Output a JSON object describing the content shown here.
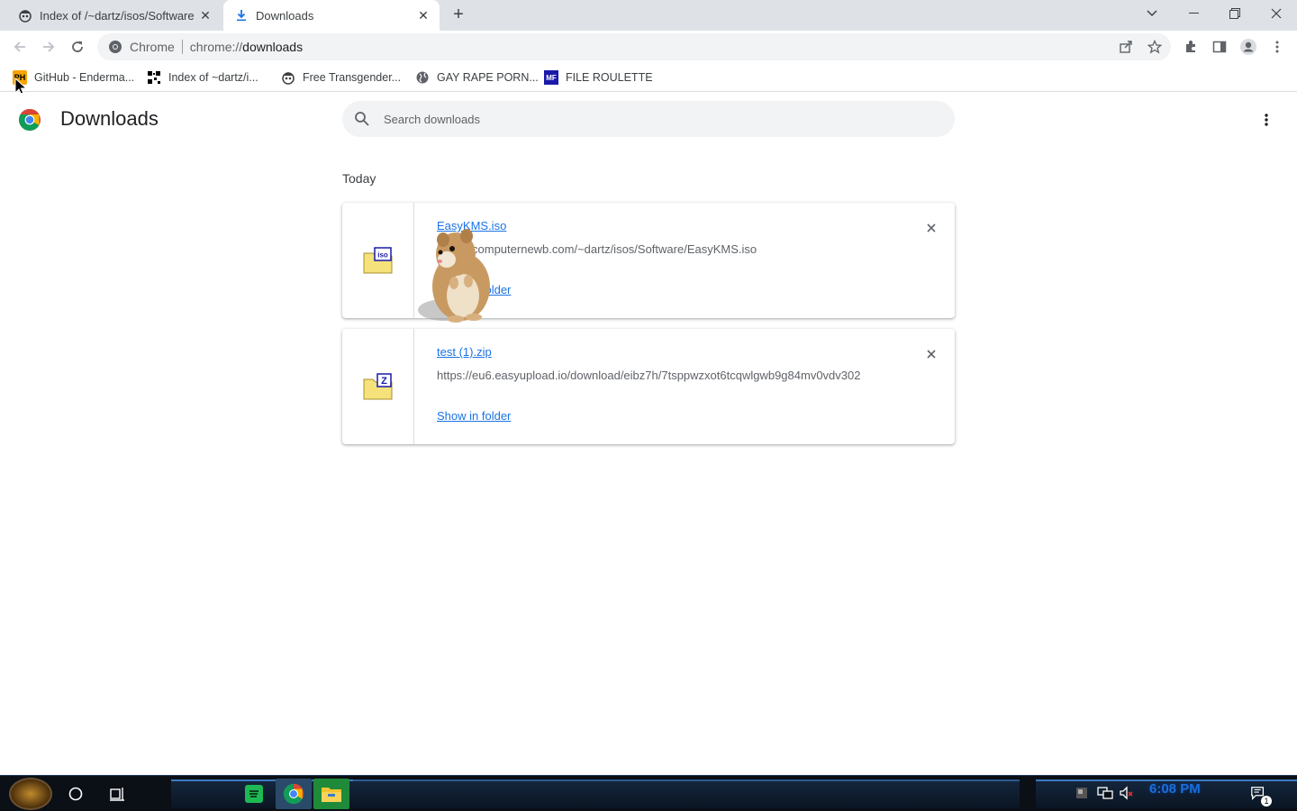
{
  "tabs": [
    {
      "title": "Index of /~dartz/isos/Software",
      "active": false
    },
    {
      "title": "Downloads",
      "active": true
    }
  ],
  "toolbar": {
    "site_chip": "Chrome",
    "url_prefix": "chrome://",
    "url_host": "downloads"
  },
  "bookmarks": [
    {
      "label": "GitHub - Enderma...",
      "icon": "ph-icon"
    },
    {
      "label": "Index of ~dartz/i...",
      "icon": "qr-icon"
    },
    {
      "label": "Free Transgender...",
      "icon": "spy-icon"
    },
    {
      "label": "GAY RAPE PORN...",
      "icon": "globe-icon"
    },
    {
      "label": "FILE ROULETTE",
      "icon": "mf-icon"
    }
  ],
  "page": {
    "title": "Downloads",
    "search_placeholder": "Search downloads",
    "date_header": "Today"
  },
  "downloads": [
    {
      "filename": "EasyKMS.iso",
      "url": "https://computernewb.com/~dartz/isos/Software/EasyKMS.iso",
      "action": "Show in folder",
      "badge": "iso"
    },
    {
      "filename": "test (1).zip",
      "url": "https://eu6.easyupload.io/download/eibz7h/7tsppwzxot6tcqwlgwb9g84mv0vdv302",
      "action": "Show in folder",
      "badge": "Z"
    }
  ],
  "taskbar": {
    "clock": "6:08 PM",
    "notification_count": "1"
  },
  "colors": {
    "accent": "#1a73e8",
    "tabstrip": "#dee1e6",
    "taskbar": "#0b0f16"
  }
}
